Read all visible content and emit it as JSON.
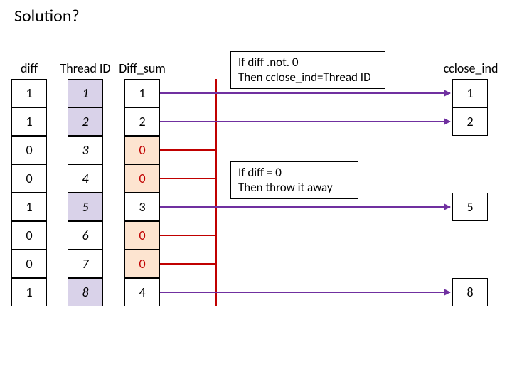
{
  "title": "Solution?",
  "headers": {
    "diff": "diff",
    "tid": "Thread ID",
    "dsum": "Diff_sum",
    "cind": "cclose_ind"
  },
  "col_diff": [
    "1",
    "1",
    "0",
    "0",
    "1",
    "0",
    "0",
    "1"
  ],
  "col_tid": [
    "1",
    "2",
    "3",
    "4",
    "5",
    "6",
    "7",
    "8"
  ],
  "col_dsum": [
    "1",
    "2",
    "0",
    "0",
    "3",
    "0",
    "0",
    "4"
  ],
  "dsum_red": [
    false,
    false,
    true,
    true,
    false,
    true,
    true,
    false
  ],
  "cclose": [
    "1",
    "2",
    "",
    "",
    "5",
    "",
    "",
    "8"
  ],
  "note_top": "If diff .not. 0\nThen cclose_ind=Thread ID",
  "note_mid": "If diff = 0\nThen throw it away"
}
